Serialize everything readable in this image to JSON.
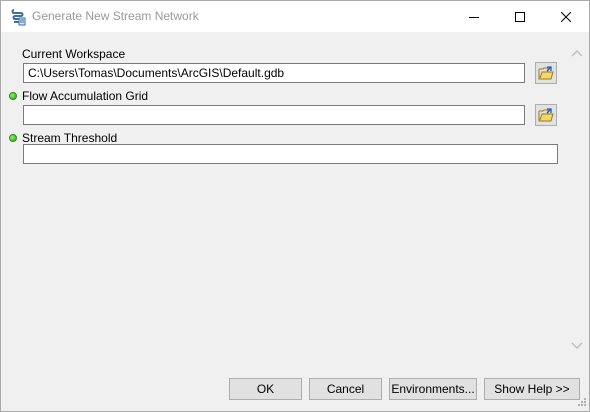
{
  "window": {
    "title": "Generate New Stream Network",
    "icon": "script-tool-icon"
  },
  "params": {
    "workspace": {
      "label": "Current Workspace",
      "value": "C:\\Users\\Tomas\\Documents\\ArcGIS\\Default.gdb",
      "required": false
    },
    "flow_accumulation": {
      "label": "Flow Accumulation Grid",
      "value": "",
      "required": true
    },
    "stream_threshold": {
      "label": "Stream Threshold",
      "value": "",
      "required": true
    }
  },
  "buttons": {
    "ok": "OK",
    "cancel": "Cancel",
    "environments": "Environments...",
    "show_help": "Show Help >>"
  },
  "colors": {
    "required_dot": "#2ea61a",
    "window_bg": "#f0f0f0",
    "title_text": "#999999"
  }
}
